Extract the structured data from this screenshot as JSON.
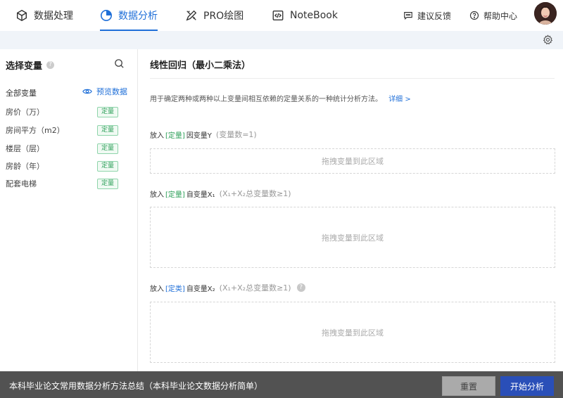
{
  "nav": {
    "tabs": [
      {
        "label": "数据处理",
        "icon": "cube-icon"
      },
      {
        "label": "数据分析",
        "icon": "pie-chart-icon"
      },
      {
        "label": "PRO绘图",
        "icon": "pencil-ruler-icon"
      },
      {
        "label": "NoteBook",
        "icon": "code-notebook-icon"
      }
    ],
    "active_tab": "数据分析",
    "feedback_label": "建议反馈",
    "help_label": "帮助中心"
  },
  "sidebar": {
    "title": "选择变量",
    "help_mark": "?",
    "all_vars_label": "全部变量",
    "preview_label": "预览数据",
    "variables": [
      {
        "name": "房价（万）",
        "tag": "定量"
      },
      {
        "name": "房间平方（m2）",
        "tag": "定量"
      },
      {
        "name": "楼层（层）",
        "tag": "定量"
      },
      {
        "name": "房龄（年）",
        "tag": "定量"
      },
      {
        "name": "配套电梯",
        "tag": "定量"
      }
    ]
  },
  "main": {
    "title": "线性回归（最小二乘法）",
    "description": "用于确定两种或两种以上变量间相互依赖的定量关系的一种统计分析方法。",
    "detail_link": "详细 >",
    "slots": [
      {
        "put": "放入",
        "type": "[定量]",
        "name": "因变量Y",
        "hint": "(变量数=1)",
        "drop_text": "拖拽变量到此区域"
      },
      {
        "put": "放入",
        "type": "[定量]",
        "name": "自变量X₁",
        "hint": "(X₁+X₂总变量数≥1)",
        "drop_text": "拖拽变量到此区域"
      },
      {
        "put": "放入",
        "type": "[定类]",
        "name": "自变量X₂",
        "hint": "(X₁+X₂总变量数≥1)",
        "help_mark": "?",
        "drop_text": "拖拽变量到此区域"
      }
    ]
  },
  "bottom": {
    "text": "本科毕业论文常用数据分析方法总结（本科毕业论文数据分析简单）",
    "reset_label": "重置",
    "start_label": "开始分析"
  },
  "colors": {
    "accent": "#1f6fd8",
    "tag_green": "#2ea05a",
    "start_button": "#2a4fb8"
  }
}
